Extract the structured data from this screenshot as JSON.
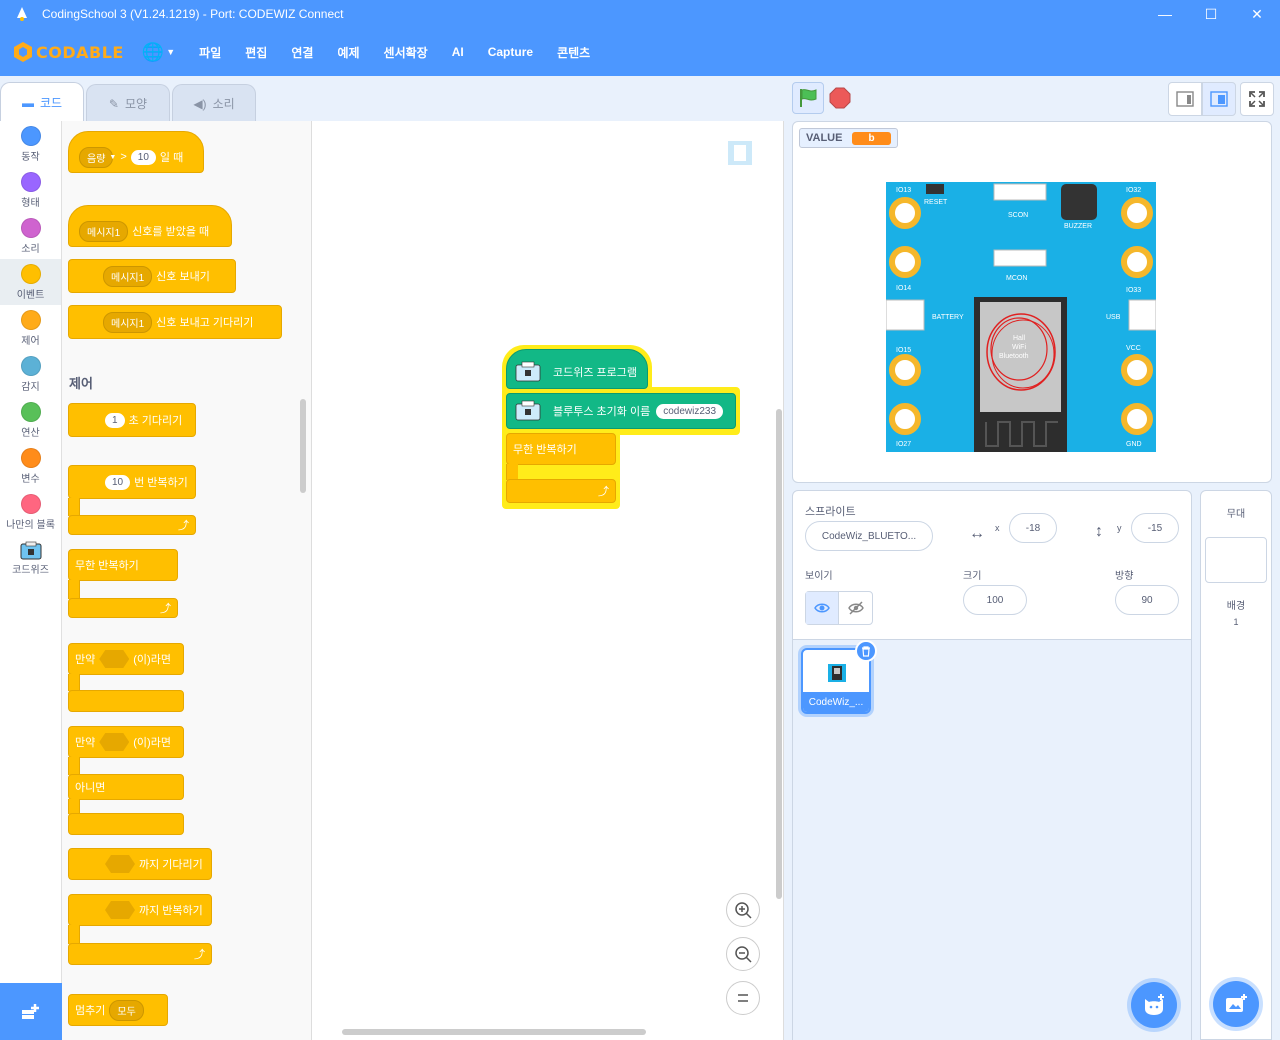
{
  "window": {
    "title": "CodingSchool 3 (V1.24.1219) - Port: CODEWIZ Connect",
    "minimize": "—",
    "maximize": "☐",
    "close": "✕"
  },
  "menubar": {
    "logo": "CODABLE",
    "items": [
      "파일",
      "편집",
      "연결",
      "예제",
      "센서확장",
      "AI",
      "Capture",
      "콘텐츠"
    ]
  },
  "tabs": [
    {
      "label": "코드",
      "icon": "code-icon"
    },
    {
      "label": "모양",
      "icon": "brush-icon"
    },
    {
      "label": "소리",
      "icon": "speaker-icon"
    }
  ],
  "categories": [
    {
      "label": "동작",
      "color": "#4c97ff"
    },
    {
      "label": "형태",
      "color": "#9966ff"
    },
    {
      "label": "소리",
      "color": "#cf63cf"
    },
    {
      "label": "이벤트",
      "color": "#ffbf00"
    },
    {
      "label": "제어",
      "color": "#ffab19"
    },
    {
      "label": "감지",
      "color": "#5cb1d6"
    },
    {
      "label": "연산",
      "color": "#59c059"
    },
    {
      "label": "변수",
      "color": "#ff8c1a"
    },
    {
      "label": "나만의 블록",
      "color": "#ff6680"
    },
    {
      "label": "코드위즈",
      "color": ""
    }
  ],
  "palette": {
    "when_gt": {
      "menu": "음량",
      "op": ">",
      "value": "10",
      "suffix": "일 때"
    },
    "when_receive": {
      "menu": "메시지1",
      "suffix": "신호를 받았을 때"
    },
    "broadcast": {
      "menu": "메시지1",
      "suffix": "신호 보내기"
    },
    "broadcast_wait": {
      "menu": "메시지1",
      "suffix": "신호 보내고 기다리기"
    },
    "section_control": "제어",
    "wait": {
      "value": "1",
      "suffix": "초 기다리기"
    },
    "repeat": {
      "value": "10",
      "suffix": "번 반복하기"
    },
    "forever": "무한 반복하기",
    "if_then": {
      "prefix": "만약",
      "suffix": "(이)라면"
    },
    "if_else": {
      "prefix": "만약",
      "suffix": "(이)라면",
      "else": "아니면"
    },
    "wait_until": "까지 기다리기",
    "repeat_until": "까지 반복하기",
    "stop": {
      "prefix": "멈추기",
      "menu": "모두"
    }
  },
  "script": {
    "program": "코드위즈 프로그램",
    "bt_init": "블루투스 초기화 이름",
    "bt_name": "codewiz233",
    "forever": "무한 반복하기"
  },
  "stage": {
    "monitor_label": "VALUE",
    "monitor_value": "b",
    "board_labels": {
      "io13": "IO13",
      "reset": "RESET",
      "scon": "SCON",
      "buzzer": "BUZZER",
      "io32": "IO32",
      "io14": "IO14",
      "mcon": "MCON",
      "io33": "IO33",
      "battery": "BATTERY",
      "usb": "USB",
      "io15": "IO15",
      "vcc": "VCC",
      "io27": "IO27",
      "gnd": "GND",
      "hall": "Hall",
      "wifi": "WiFi",
      "bluetooth": "Bluetooth"
    }
  },
  "sprite": {
    "label": "스프라이트",
    "name": "CodeWiz_BLUETO...",
    "x_label": "x",
    "x": "-18",
    "y_label": "y",
    "y": "-15",
    "show_label": "보이기",
    "size_label": "크기",
    "size": "100",
    "direction_label": "방향",
    "direction": "90",
    "thumb_name": "CodeWiz_..."
  },
  "stage_selector": {
    "title": "무대",
    "backdrop_label": "배경",
    "backdrop_count": "1"
  }
}
